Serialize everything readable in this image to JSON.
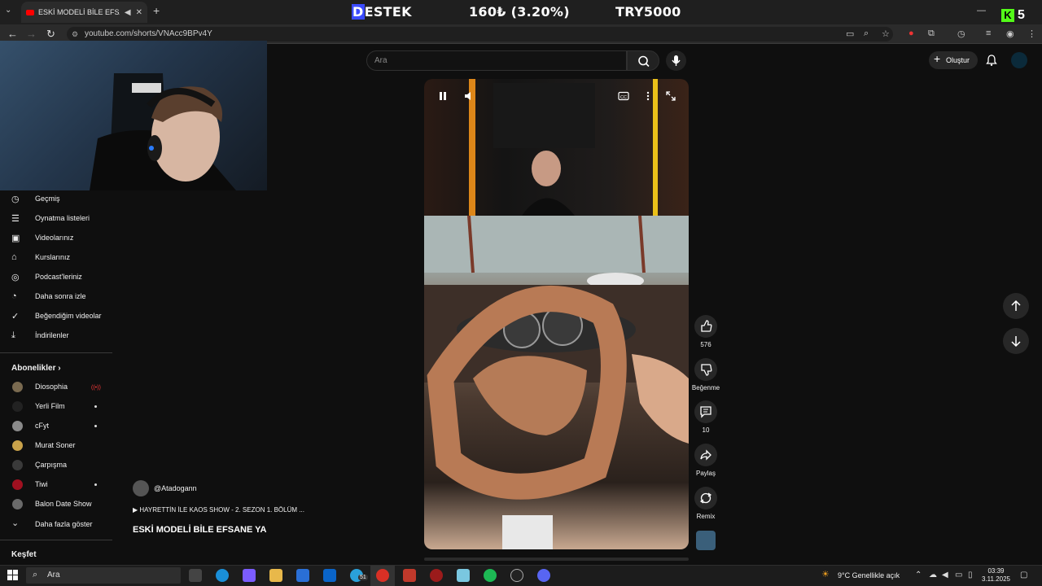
{
  "browser": {
    "tab_title": "ESKİ MODELİ BİLE EFSANE YA",
    "url": "youtube.com/shorts/VNAcc9BPv4Y"
  },
  "overlay": {
    "destek_first": "D",
    "destek_rest": "ESTEK",
    "goal": "160₺ (3.20%)",
    "target": "TRY5000",
    "kick_letter": "K",
    "kick_count": "5"
  },
  "header": {
    "search_placeholder": "Ara",
    "create_label": "Oluştur"
  },
  "sidebar": {
    "items": [
      {
        "label": "Geçmiş",
        "icon": "history-icon"
      },
      {
        "label": "Oynatma listeleri",
        "icon": "playlist-icon"
      },
      {
        "label": "Videolarınız",
        "icon": "your-videos-icon"
      },
      {
        "label": "Kurslarınız",
        "icon": "courses-icon"
      },
      {
        "label": "Podcast'leriniz",
        "icon": "podcast-icon"
      },
      {
        "label": "Daha sonra izle",
        "icon": "watch-later-icon"
      },
      {
        "label": "Beğendiğim videolar",
        "icon": "liked-icon"
      },
      {
        "label": "İndirilenler",
        "icon": "download-icon"
      }
    ],
    "subs_heading": "Abonelikler",
    "subscriptions": [
      {
        "name": "Diosophia",
        "live": true,
        "dot": false,
        "color": "#7a6a50"
      },
      {
        "name": "Yerli Film",
        "live": false,
        "dot": true,
        "color": "#222222"
      },
      {
        "name": "cFyt",
        "live": false,
        "dot": true,
        "color": "#8a8a8a"
      },
      {
        "name": "Murat Soner",
        "live": false,
        "dot": false,
        "color": "#c9a24a"
      },
      {
        "name": "Çarpışma",
        "live": false,
        "dot": false,
        "color": "#3a3a3a"
      },
      {
        "name": "Tiwi",
        "live": false,
        "dot": true,
        "color": "#a01020"
      },
      {
        "name": "Balon Date Show",
        "live": false,
        "dot": false,
        "color": "#6a6a6a"
      }
    ],
    "show_more": "Daha fazla göster",
    "explore": "Keşfet"
  },
  "video": {
    "channel": "@Atadogann",
    "song": "HAYRETTİN İLE KAOS SHOW - 2. SEZON 1. BÖLÜM ...",
    "title": "ESKİ MODELİ BİLE EFSANE YA"
  },
  "actions": {
    "likes": "576",
    "dislike_label": "Beğenme",
    "comments": "10",
    "share_label": "Paylaş",
    "remix_label": "Remix"
  },
  "taskbar": {
    "search_label": "Ara",
    "temperature": "9°C",
    "weather": "Genellikle açık",
    "time": "03:39",
    "date": "3.11.2025",
    "badge": "51"
  }
}
